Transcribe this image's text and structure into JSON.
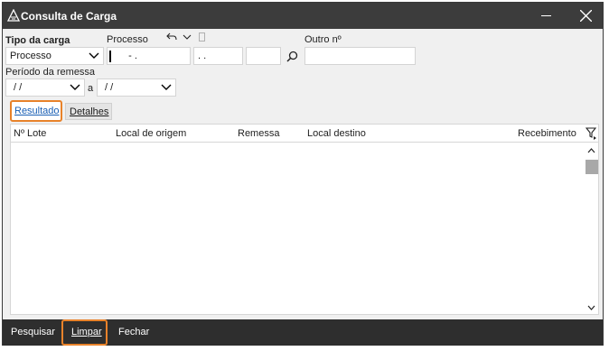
{
  "window": {
    "title": "Consulta de Carga"
  },
  "form": {
    "tipo_label": "Tipo da carga",
    "tipo_value": "Processo",
    "processo_label": "Processo",
    "processo_value": "   - .",
    "processo_part2": ". .",
    "outro_label": "Outro nº",
    "periodo_label": "Período da remessa",
    "periodo_from": "/ /",
    "periodo_sep": "a",
    "periodo_to": "/ /"
  },
  "tabs": [
    {
      "label": "Resultado",
      "active": true
    },
    {
      "label": "Detalhes",
      "active": false
    }
  ],
  "grid": {
    "columns": [
      "Nº Lote",
      "Local de origem",
      "Remessa",
      "Local destino",
      "Recebimento"
    ]
  },
  "footer": {
    "pesquisar": "Pesquisar",
    "limpar": "Limpar",
    "fechar": "Fechar"
  },
  "colors": {
    "titlebar": "#3c3c3c",
    "focus": "#e8822a",
    "link": "#1a5fb4"
  },
  "icons": [
    "app-logo-icon",
    "undo-icon",
    "chevron-down-icon",
    "search-icon",
    "filter-icon",
    "scroll-up-icon",
    "scroll-down-icon",
    "close-icon",
    "minimize-icon"
  ]
}
